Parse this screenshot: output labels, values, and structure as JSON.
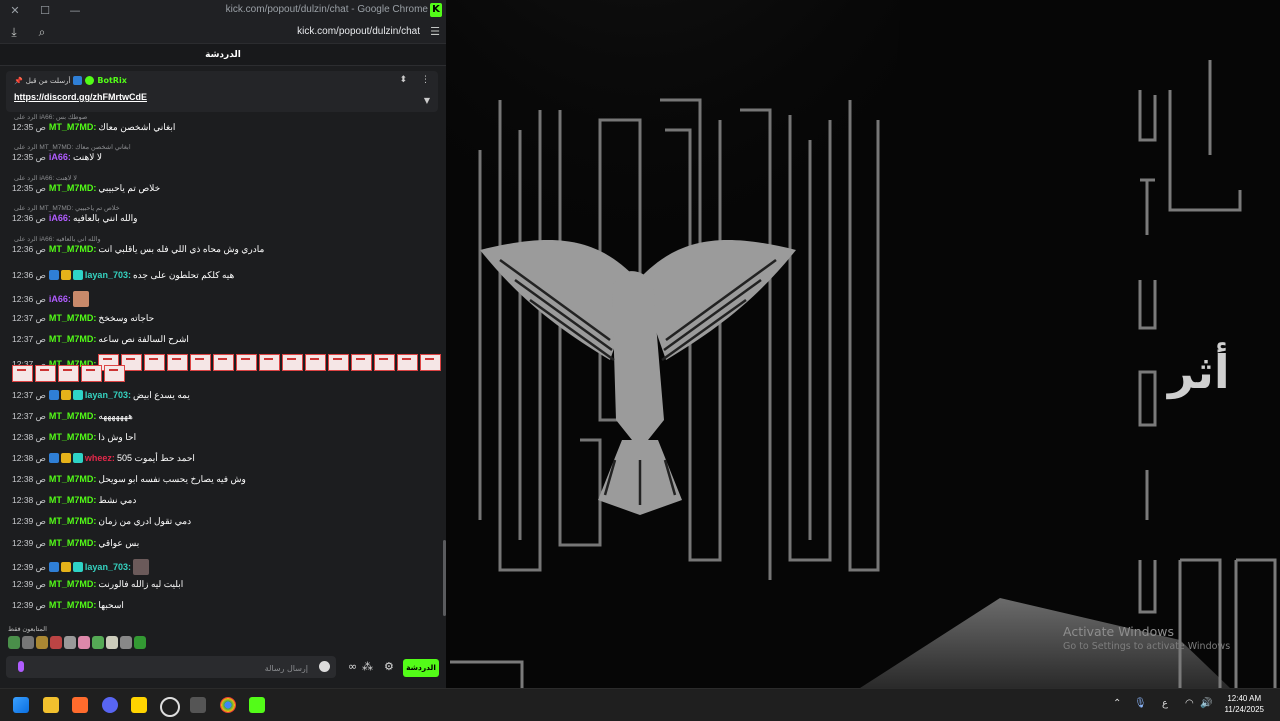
{
  "browser": {
    "title": "kick.com/popout/dulzin/chat - Google Chrome",
    "url": "kick.com/popout/dulzin/chat"
  },
  "chat": {
    "header": "الدردشة",
    "pinned": {
      "label": "أرسلت من قبل",
      "bot": "BotRix",
      "link": "https://discord.gg/zhFMrtwCdE"
    },
    "messages": [
      {
        "reply": "الرد على iA66: صوطك بس",
        "time": "12:35 ص",
        "user": "MT_M7MD:",
        "color": "green",
        "badges": [],
        "text": "ابغاني اشخصن معاك"
      },
      {
        "reply": "الرد على MT_M7MD: ابغاني اشخصن معاك",
        "time": "12:35 ص",
        "user": "iA66:",
        "color": "purple",
        "badges": [],
        "text": "لا لاهنت"
      },
      {
        "reply": "الرد على iA66: لا لاهنت",
        "time": "12:35 ص",
        "user": "MT_M7MD:",
        "color": "green",
        "badges": [],
        "text": "خلاص تم ياحبيبي"
      },
      {
        "reply": "الرد على MT_M7MD: خلاص تم ياحبيبي",
        "time": "12:36 ص",
        "user": "iA66:",
        "color": "purple",
        "badges": [],
        "text": "والله انني بالعافيه"
      },
      {
        "reply": "الرد على iA66: والله اني بالعافيه",
        "time": "12:36 ص",
        "user": "MT_M7MD:",
        "color": "green",
        "badges": [],
        "text": "مادري وش محاه ذي اللي فله بس ياقلبي انت"
      },
      {
        "reply": "",
        "time": "12:36 ص",
        "user": "layan_703:",
        "color": "teal",
        "badges": [
          "blue",
          "gold",
          "cyan"
        ],
        "text": "هيه كلكم تحلطون على جده"
      },
      {
        "reply": "",
        "time": "12:36 ص",
        "user": "iA66:",
        "color": "purple",
        "badges": [],
        "text": ""
      },
      {
        "reply": "",
        "time": "12:37 ص",
        "user": "MT_M7MD:",
        "color": "green",
        "badges": [],
        "text": "حاجاته وسخخخ"
      },
      {
        "reply": "",
        "time": "12:37 ص",
        "user": "MT_M7MD:",
        "color": "green",
        "badges": [],
        "text": "اشرح السالفة نص ساعه"
      },
      {
        "reply": "",
        "time": "12:37 ص",
        "user": "MT_M7MD:",
        "color": "green",
        "badges": [],
        "text": ""
      },
      {
        "reply": "",
        "time": "12:37 ص",
        "user": "layan_703:",
        "color": "teal",
        "badges": [
          "blue",
          "gold",
          "cyan"
        ],
        "text": "يمه يسدع ابيض"
      },
      {
        "reply": "",
        "time": "12:37 ص",
        "user": "MT_M7MD:",
        "color": "green",
        "badges": [],
        "text": "هههههههه"
      },
      {
        "reply": "",
        "time": "12:38 ص",
        "user": "MT_M7MD:",
        "color": "green",
        "badges": [],
        "text": "احا وش ذا"
      },
      {
        "reply": "",
        "time": "12:38 ص",
        "user": "wheez:",
        "color": "red",
        "badges": [
          "blue",
          "gold",
          "cyan"
        ],
        "text": "احمد حط أيموت 505"
      },
      {
        "reply": "",
        "time": "12:38 ص",
        "user": "MT_M7MD:",
        "color": "green",
        "badges": [],
        "text": "وش فيه يصارخ يحسب نفسه ابو سويحل"
      },
      {
        "reply": "",
        "time": "12:38 ص",
        "user": "MT_M7MD:",
        "color": "green",
        "badges": [],
        "text": "دمي نشط"
      },
      {
        "reply": "",
        "time": "12:39 ص",
        "user": "MT_M7MD:",
        "color": "green",
        "badges": [],
        "text": "دمي تقول ادري من زمان"
      },
      {
        "reply": "",
        "time": "12:39 ص",
        "user": "MT_M7MD:",
        "color": "green",
        "badges": [],
        "text": "بس عواقي"
      },
      {
        "reply": "",
        "time": "12:39 ص",
        "user": "layan_703:",
        "color": "teal",
        "badges": [
          "blue",
          "gold",
          "cyan"
        ],
        "text": ""
      },
      {
        "reply": "",
        "time": "12:39 ص",
        "user": "MT_M7MD:",
        "color": "green",
        "badges": [],
        "text": "ابليت ليه زالله فالورنت"
      },
      {
        "reply": "",
        "time": "12:39 ص",
        "user": "MT_M7MD:",
        "color": "green",
        "badges": [],
        "text": "اسحبها"
      }
    ],
    "viewers_label": "المتابعون فقط",
    "input_placeholder": "إرسال رسالة",
    "send_button": "الدردشة"
  },
  "stream": {
    "side_text": "أثر"
  },
  "watermark": {
    "line1": "Activate Windows",
    "line2": "Go to Settings to activate Windows"
  },
  "taskbar": {
    "lang": "ع",
    "time": "12:40 AM",
    "date": "11/24/2025"
  },
  "colors": {
    "kick_green": "#53fc18",
    "purple": "#b05cff",
    "teal": "#35d2c0",
    "red": "#e2284a"
  }
}
